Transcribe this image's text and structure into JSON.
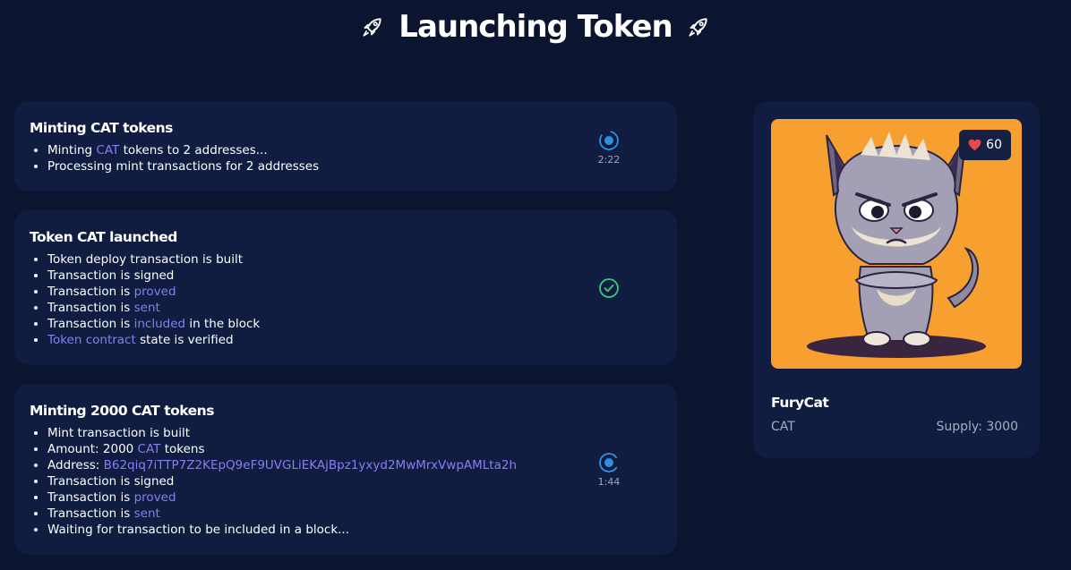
{
  "header": {
    "title": "Launching Token",
    "icon_left": "rocket-icon",
    "icon_right": "rocket-icon"
  },
  "cards": [
    {
      "title": "Minting CAT tokens",
      "status": "in-progress",
      "timer": "2:22",
      "items": [
        [
          "Minting ",
          "CAT",
          " tokens to 2 addresses..."
        ],
        [
          "Processing mint transactions for 2 addresses"
        ]
      ]
    },
    {
      "title": "Token CAT launched",
      "status": "complete",
      "items": [
        [
          "Token deploy transaction is built"
        ],
        [
          "Transaction is signed"
        ],
        [
          "Transaction is ",
          "proved"
        ],
        [
          "Transaction is ",
          "sent"
        ],
        [
          "Transaction is ",
          "included",
          " in the block"
        ],
        [
          "",
          "Token contract",
          " state is verified"
        ]
      ]
    },
    {
      "title": "Minting 2000 CAT tokens",
      "status": "in-progress",
      "timer": "1:44",
      "items": [
        [
          "Mint transaction is built"
        ],
        [
          "Amount: 2000 ",
          "CAT",
          " tokens"
        ],
        [
          "Address: ",
          "B62qiq7iTTP7Z2KEpQ9eF9UVGLiEKAjBpz1yxyd2MwMrxVwpAMLta2h"
        ],
        [
          "Transaction is signed"
        ],
        [
          "Transaction is ",
          "proved"
        ],
        [
          "Transaction is ",
          "sent"
        ],
        [
          "Waiting for transaction to be included in a block..."
        ]
      ]
    }
  ],
  "token": {
    "name": "FuryCat",
    "symbol": "CAT",
    "supply": "Supply: 3000",
    "likes": "60",
    "image": "angry-cat-illustration",
    "background_color": "#f7a030"
  },
  "colors": {
    "background": "#0b1530",
    "card": "#101c40",
    "link": "#8b7cf6",
    "progress": "#2f8fe0",
    "success": "#3ec77a",
    "heart": "#e5484d"
  }
}
